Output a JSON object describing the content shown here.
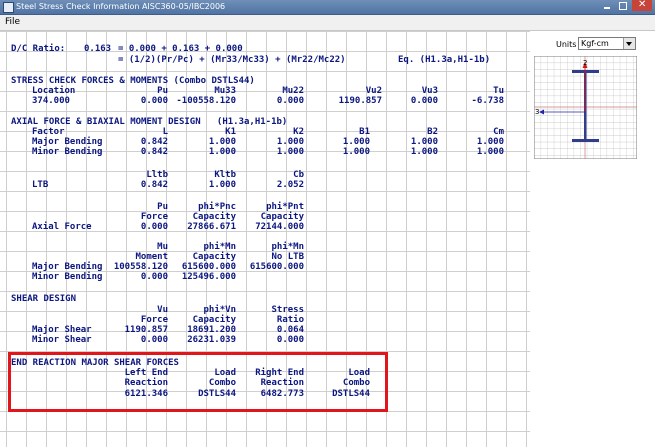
{
  "window": {
    "title": "Steel Stress Check Information  AISC360-05/IBC2006"
  },
  "menu": {
    "file": "File"
  },
  "units": {
    "label": "Units",
    "value": "Kgf-cm"
  },
  "section_view": {
    "axis_major": "2",
    "axis_minor": "3"
  },
  "report": {
    "dc": {
      "label": "D/C Ratio:",
      "ratio": "0.163",
      "equation1": "= 0.000 + 0.163 + 0.000",
      "equation2": "= (1/2)(Pr/Pc) + (Mr33/Mc33) + (Mr22/Mc22)",
      "eq_ref": "Eq. (H1.3a,H1-1b)"
    },
    "forces": {
      "title": "STRESS CHECK FORCES & MOMENTS (Combo DSTLS44)",
      "headers": [
        "Location",
        "Pu",
        "Mu33",
        "Mu22",
        "Vu2",
        "Vu3",
        "Tu"
      ],
      "values": [
        "374.000",
        "0.000",
        "-100558.120",
        "0.000",
        "1190.857",
        "0.000",
        "-6.738"
      ]
    },
    "axial": {
      "title": "AXIAL FORCE & BIAXIAL MOMENT DESIGN   (H1.3a,H1-1b)",
      "headers": [
        "Factor",
        "L",
        "K1",
        "K2",
        "B1",
        "B2",
        "Cm"
      ],
      "major": [
        "Major Bending",
        "0.842",
        "1.000",
        "1.000",
        "1.000",
        "1.000",
        "1.000"
      ],
      "minor": [
        "Minor Bending",
        "0.842",
        "1.000",
        "1.000",
        "1.000",
        "1.000",
        "1.000"
      ],
      "ltb_headers": [
        "Lltb",
        "Kltb",
        "Cb"
      ],
      "ltb": [
        "LTB",
        "0.842",
        "1.000",
        "2.052"
      ],
      "axial_headers1": [
        "Pu",
        "phi*Pnc",
        "phi*Pnt"
      ],
      "axial_headers2": [
        "Force",
        "Capacity",
        "Capacity"
      ],
      "axial_force": [
        "Axial Force",
        "0.000",
        "27866.671",
        "72144.000"
      ],
      "moment_headers1": [
        "Mu",
        "phi*Mn",
        "phi*Mn"
      ],
      "moment_headers2": [
        "Moment",
        "Capacity",
        "No LTB"
      ],
      "major_moment": [
        "Major Bending",
        "100558.120",
        "615600.000",
        "615600.000"
      ],
      "minor_moment": [
        "Minor Bending",
        "0.000",
        "125496.000"
      ]
    },
    "shear": {
      "title": "SHEAR DESIGN",
      "headers1": [
        "Vu",
        "phi*Vn",
        "Stress"
      ],
      "headers2": [
        "Force",
        "Capacity",
        "Ratio"
      ],
      "major": [
        "Major Shear",
        "1190.857",
        "18691.200",
        "0.064"
      ],
      "minor": [
        "Minor Shear",
        "0.000",
        "26231.039",
        "0.000"
      ]
    },
    "end_reaction": {
      "title": "END REACTION MAJOR SHEAR FORCES",
      "headers1": [
        "Left End",
        "Load",
        "Right End",
        "Load"
      ],
      "headers2": [
        "Reaction",
        "Combo",
        "Reaction",
        "Combo"
      ],
      "values": [
        "6121.346",
        "DSTLS44",
        "6482.773",
        "DSTLS44"
      ]
    }
  },
  "colors": {
    "report_text": "#0b1680",
    "highlight": "#e0161b",
    "titlebar": "#4f73a3"
  }
}
